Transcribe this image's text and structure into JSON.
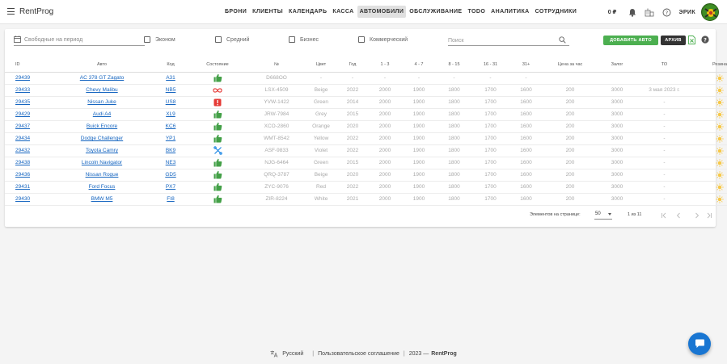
{
  "app": {
    "brand": "RentProg"
  },
  "nav": {
    "items": [
      "БРОНИ",
      "КЛИЕНТЫ",
      "КАЛЕНДАРЬ",
      "КАССА",
      "АВТОМОБИЛИ",
      "ОБСЛУЖИВАНИЕ",
      "TODO",
      "АНАЛИТИКА",
      "СОТРУДНИКИ"
    ],
    "active_index": 4
  },
  "top_right": {
    "balance": "0 ₽",
    "user_name": "ЭРИК",
    "icons": [
      "bell-icon",
      "building-icon",
      "help-icon"
    ]
  },
  "filters": {
    "period_placeholder": "Свободные на период",
    "checkboxes": [
      "Эконом",
      "Средний",
      "Бизнес",
      "Коммерческий"
    ],
    "search_placeholder": "Поиск",
    "add_button": "ДОБАВИТЬ АВТО",
    "archive_button": "АРХИВ"
  },
  "table": {
    "headers": [
      "ID",
      "Авто",
      "Код",
      "Состояние",
      "№",
      "Цвет",
      "Год",
      "1 - 3",
      "4 - 7",
      "8 - 15",
      "16 - 31",
      "31+",
      "Цена за час",
      "Залог",
      "ТО",
      "Резина"
    ],
    "rows": [
      {
        "id": "29439",
        "car": "AC 378 GT Zagato",
        "code": "A31",
        "state": "thumbs-up",
        "number": "D668OO",
        "color": "-",
        "year": "-",
        "p1": "-",
        "p2": "-",
        "p3": "-",
        "p4": "-",
        "p5": "-",
        "hour": "",
        "deposit": "",
        "to": "",
        "tire": "sun"
      },
      {
        "id": "29433",
        "car": "Chevy Malibu",
        "code": "NB5",
        "state": "infinity",
        "number": "LSX-4509",
        "color": "Beige",
        "year": "2022",
        "p1": "2000",
        "p2": "1900",
        "p3": "1800",
        "p4": "1700",
        "p5": "1600",
        "hour": "200",
        "deposit": "3000",
        "to": "3 мая 2023 г.",
        "tire": "sun"
      },
      {
        "id": "29435",
        "car": "Nissan Juke",
        "code": "US8",
        "state": "alert",
        "number": "YVW-1422",
        "color": "Green",
        "year": "2014",
        "p1": "2000",
        "p2": "1900",
        "p3": "1800",
        "p4": "1700",
        "p5": "1600",
        "hour": "200",
        "deposit": "3000",
        "to": "-",
        "tire": "sun"
      },
      {
        "id": "29429",
        "car": "Audi A4",
        "code": "XL9",
        "state": "thumbs-up",
        "number": "JRW-7984",
        "color": "Grey",
        "year": "2015",
        "p1": "2000",
        "p2": "1900",
        "p3": "1800",
        "p4": "1700",
        "p5": "1600",
        "hour": "200",
        "deposit": "3000",
        "to": "-",
        "tire": "sun"
      },
      {
        "id": "29437",
        "car": "Buick Encore",
        "code": "KC6",
        "state": "thumbs-up",
        "number": "XCO-2860",
        "color": "Orange",
        "year": "2020",
        "p1": "2000",
        "p2": "1900",
        "p3": "1800",
        "p4": "1700",
        "p5": "1600",
        "hour": "200",
        "deposit": "3000",
        "to": "-",
        "tire": "sun"
      },
      {
        "id": "29434",
        "car": "Dodge Challenger",
        "code": "YP1",
        "state": "thumbs-up",
        "number": "WMT-8542",
        "color": "Yellow",
        "year": "2022",
        "p1": "2000",
        "p2": "1900",
        "p3": "1800",
        "p4": "1700",
        "p5": "1600",
        "hour": "200",
        "deposit": "3000",
        "to": "-",
        "tire": "sun"
      },
      {
        "id": "29432",
        "car": "Toyota Camry",
        "code": "BK9",
        "state": "tools",
        "number": "ASF-9833",
        "color": "Violet",
        "year": "2022",
        "p1": "2000",
        "p2": "1900",
        "p3": "1800",
        "p4": "1700",
        "p5": "1600",
        "hour": "200",
        "deposit": "3000",
        "to": "-",
        "tire": "sun"
      },
      {
        "id": "29438",
        "car": "Lincoln Navigator",
        "code": "NE3",
        "state": "thumbs-up",
        "number": "NJG-6464",
        "color": "Green",
        "year": "2015",
        "p1": "2000",
        "p2": "1900",
        "p3": "1800",
        "p4": "1700",
        "p5": "1600",
        "hour": "200",
        "deposit": "3000",
        "to": "-",
        "tire": "sun"
      },
      {
        "id": "29436",
        "car": "Nissan Rogue",
        "code": "GD5",
        "state": "thumbs-up",
        "number": "QRQ-3787",
        "color": "Beige",
        "year": "2020",
        "p1": "2000",
        "p2": "1900",
        "p3": "1800",
        "p4": "1700",
        "p5": "1600",
        "hour": "200",
        "deposit": "3000",
        "to": "-",
        "tire": "sun"
      },
      {
        "id": "29431",
        "car": "Ford Focus",
        "code": "PX7",
        "state": "thumbs-up",
        "number": "ZYC-9076",
        "color": "Red",
        "year": "2022",
        "p1": "2000",
        "p2": "1900",
        "p3": "1800",
        "p4": "1700",
        "p5": "1600",
        "hour": "200",
        "deposit": "3000",
        "to": "-",
        "tire": "sun"
      },
      {
        "id": "29430",
        "car": "BMW M5",
        "code": "FI8",
        "state": "thumbs-up",
        "number": "ZIR-8224",
        "color": "White",
        "year": "2021",
        "p1": "2000",
        "p2": "1900",
        "p3": "1800",
        "p4": "1700",
        "p5": "1600",
        "hour": "200",
        "deposit": "3000",
        "to": "-",
        "tire": "sun"
      }
    ]
  },
  "pagination": {
    "label": "Элементов на странице:",
    "per_page": "50",
    "range": "1 из 11"
  },
  "footer": {
    "language": "Русский",
    "agreement": "Пользовательское соглашение",
    "year": "2023 —",
    "brand": "RentProg"
  },
  "colors": {
    "accent_green": "#4caf50",
    "link_blue": "#1565c0",
    "state_green": "#43a047",
    "state_red": "#e53935",
    "tools_blue": "#1e88e5",
    "sun_yellow": "#f7c948",
    "chat_blue": "#1976d2"
  }
}
